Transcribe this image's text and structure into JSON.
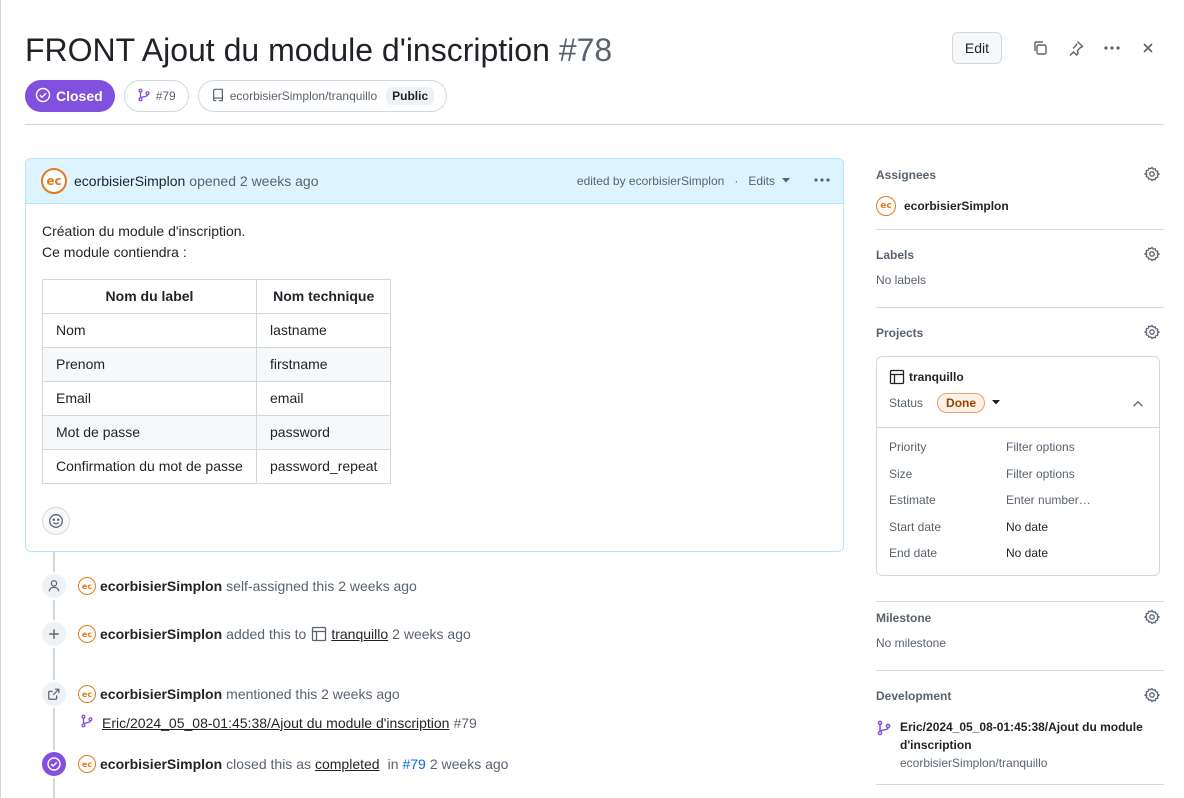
{
  "issue": {
    "title": "FRONT Ajout du module d'inscription",
    "number": "#78",
    "state": "Closed",
    "linked_pr": "#79",
    "repo": "ecorbisierSimplon/tranquillo",
    "visibility": "Public"
  },
  "header": {
    "edit_label": "Edit"
  },
  "comment": {
    "author": "ecorbisierSimplon",
    "action": "opened 2 weeks ago",
    "edited_by": "edited by ecorbisierSimplon",
    "separator": "·",
    "edits_label": "Edits",
    "body_line1": "Création du module d'inscription.",
    "body_line2": "Ce module contiendra :",
    "table": {
      "headers": [
        "Nom du label",
        "Nom technique"
      ],
      "rows": [
        [
          "Nom",
          "lastname"
        ],
        [
          "Prenom",
          "firstname"
        ],
        [
          "Email",
          "email"
        ],
        [
          "Mot de passe",
          "password"
        ],
        [
          "Confirmation du mot de passe",
          "password_repeat"
        ]
      ]
    }
  },
  "avatar_text": "ec",
  "timeline": [
    {
      "user": "ecorbisierSimplon",
      "text": "self-assigned this 2 weeks ago"
    },
    {
      "user": "ecorbisierSimplon",
      "pre": "added this to",
      "link": "tranquillo",
      "post": "2 weeks ago"
    },
    {
      "user": "ecorbisierSimplon",
      "text": "mentioned this 2 weeks ago",
      "sub_link": "Eric/2024_05_08-01:45:38/Ajout du module d'inscription",
      "sub_num": "#79"
    },
    {
      "user": "ecorbisierSimplon",
      "pre": "closed this as",
      "link": "completed",
      "mid": "in",
      "num": "#79",
      "post": "2 weeks ago"
    }
  ],
  "sidebar": {
    "assignees": {
      "title": "Assignees",
      "user": "ecorbisierSimplon"
    },
    "labels": {
      "title": "Labels",
      "value": "No labels"
    },
    "projects": {
      "title": "Projects",
      "project_name": "tranquillo",
      "status_label": "Status",
      "status_value": "Done",
      "fields": [
        {
          "key": "Priority",
          "value": "Filter options"
        },
        {
          "key": "Size",
          "value": "Filter options"
        },
        {
          "key": "Estimate",
          "value": "Enter number…"
        },
        {
          "key": "Start date",
          "value": "No date"
        },
        {
          "key": "End date",
          "value": "No date"
        }
      ]
    },
    "milestone": {
      "title": "Milestone",
      "value": "No milestone"
    },
    "development": {
      "title": "Development",
      "branch": "Eric/2024_05_08-01:45:38/Ajout du module d'inscription",
      "repo": "ecorbisierSimplon/tranquillo"
    }
  },
  "colors": {
    "closed_purple": "#8250df",
    "comment_header_bg": "#ddf4ff",
    "done_badge_bg": "#fff1e5",
    "link_blue": "#0969da"
  }
}
